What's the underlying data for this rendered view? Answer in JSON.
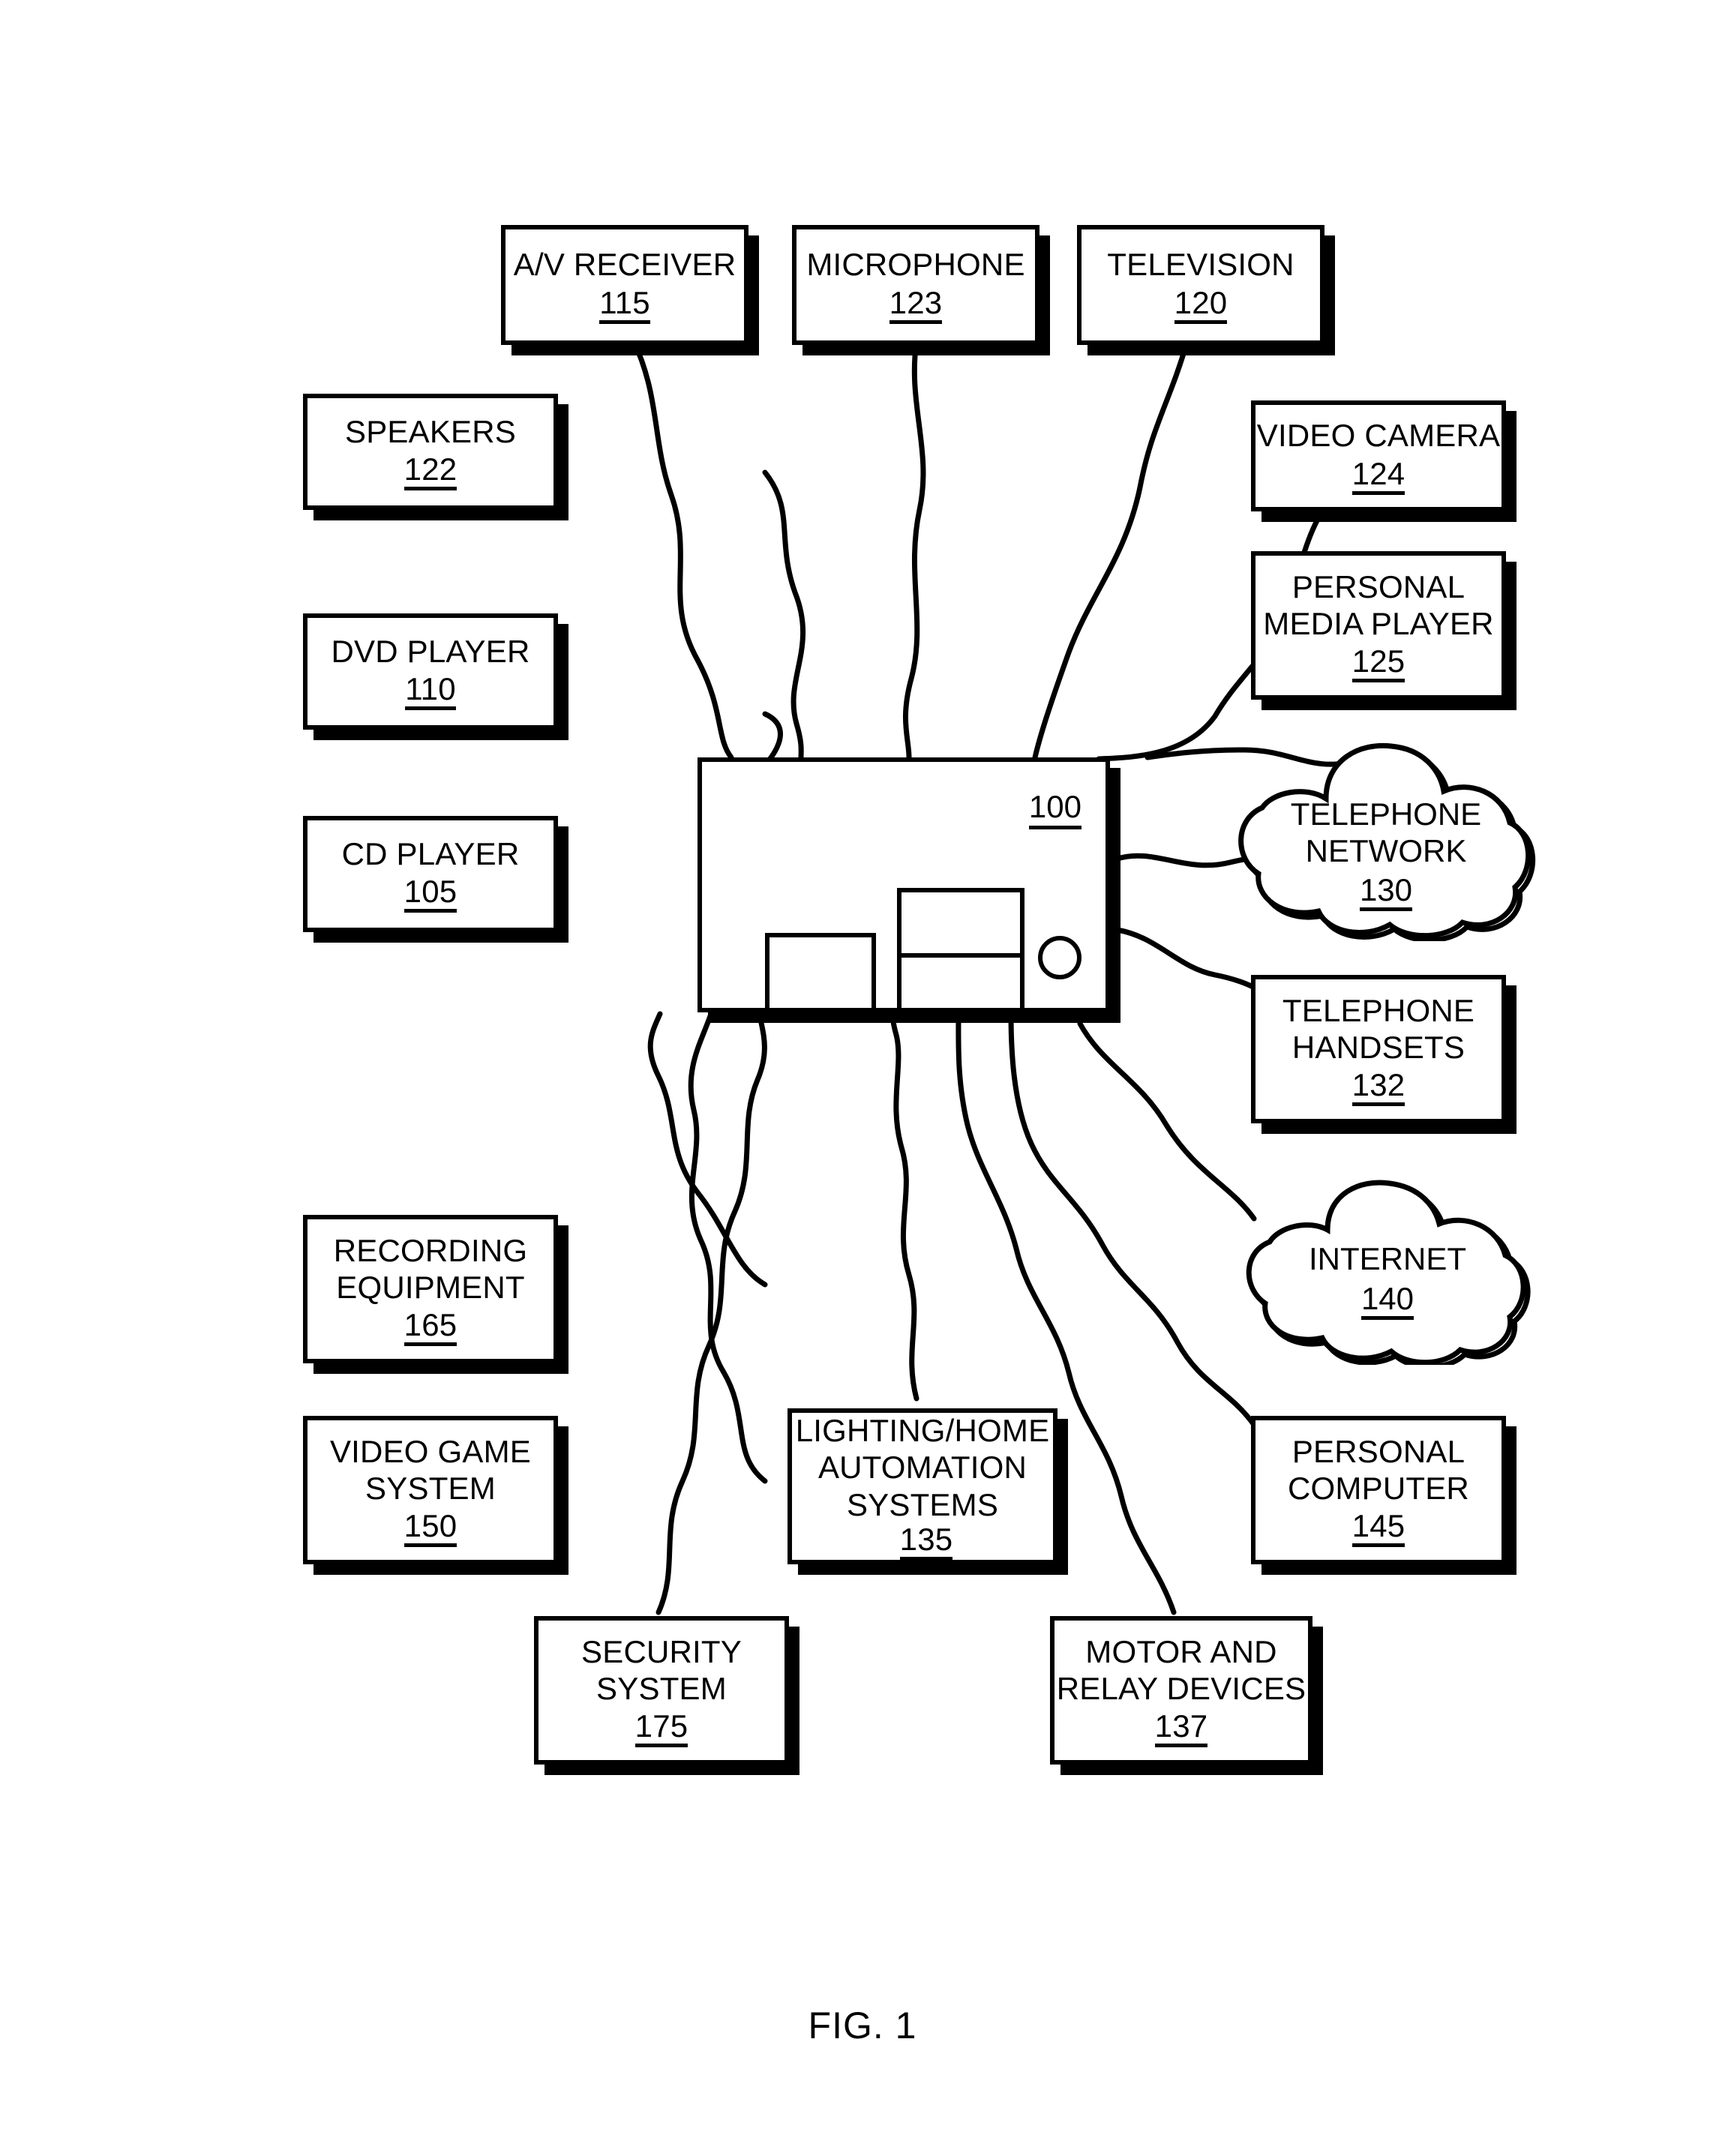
{
  "figure": {
    "caption": "FIG. 1",
    "hub": {
      "ref": "100",
      "name": "central-hub-device"
    }
  },
  "nodes": [
    {
      "id": "av-receiver",
      "label": "A/V RECEIVER",
      "ref": "115",
      "shape": "box",
      "inline_ref": false
    },
    {
      "id": "microphone",
      "label": "MICROPHONE",
      "ref": "123",
      "shape": "box",
      "inline_ref": false
    },
    {
      "id": "television",
      "label": "TELEVISION",
      "ref": "120",
      "shape": "box",
      "inline_ref": false
    },
    {
      "id": "speakers",
      "label": "SPEAKERS",
      "ref": "122",
      "shape": "box",
      "inline_ref": false
    },
    {
      "id": "dvd-player",
      "label": "DVD PLAYER",
      "ref": "110",
      "shape": "box",
      "inline_ref": false
    },
    {
      "id": "cd-player",
      "label": "CD PLAYER",
      "ref": "105",
      "shape": "box",
      "inline_ref": false
    },
    {
      "id": "video-camera",
      "label": "VIDEO CAMERA",
      "ref": "124",
      "shape": "box",
      "inline_ref": false
    },
    {
      "id": "personal-media-player",
      "label": "PERSONAL\nMEDIA PLAYER",
      "ref": "125",
      "shape": "box",
      "inline_ref": false
    },
    {
      "id": "telephone-network",
      "label": "TELEPHONE\nNETWORK",
      "ref": "130",
      "shape": "cloud",
      "inline_ref": false
    },
    {
      "id": "telephone-handsets",
      "label": "TELEPHONE\nHANDSETS",
      "ref": "132",
      "shape": "box",
      "inline_ref": false
    },
    {
      "id": "internet",
      "label": "INTERNET",
      "ref": "140",
      "shape": "cloud",
      "inline_ref": false
    },
    {
      "id": "recording-equipment",
      "label": "RECORDING\nEQUIPMENT",
      "ref": "165",
      "shape": "box",
      "inline_ref": false
    },
    {
      "id": "video-game-system",
      "label": "VIDEO GAME\nSYSTEM",
      "ref": "150",
      "shape": "box",
      "inline_ref": false
    },
    {
      "id": "lighting-home-automation",
      "label": "LIGHTING/HOME\nAUTOMATION\nSYSTEMS",
      "ref": "135",
      "shape": "box",
      "inline_ref": true
    },
    {
      "id": "personal-computer",
      "label": "PERSONAL\nCOMPUTER",
      "ref": "145",
      "shape": "box",
      "inline_ref": false
    },
    {
      "id": "security-system",
      "label": "SECURITY\nSYSTEM",
      "ref": "175",
      "shape": "box",
      "inline_ref": false
    },
    {
      "id": "motor-relay-devices",
      "label": "MOTOR AND\nRELAY DEVICES",
      "ref": "137",
      "shape": "box",
      "inline_ref": false
    }
  ],
  "colors": {
    "line": "#000000",
    "background": "#ffffff"
  }
}
